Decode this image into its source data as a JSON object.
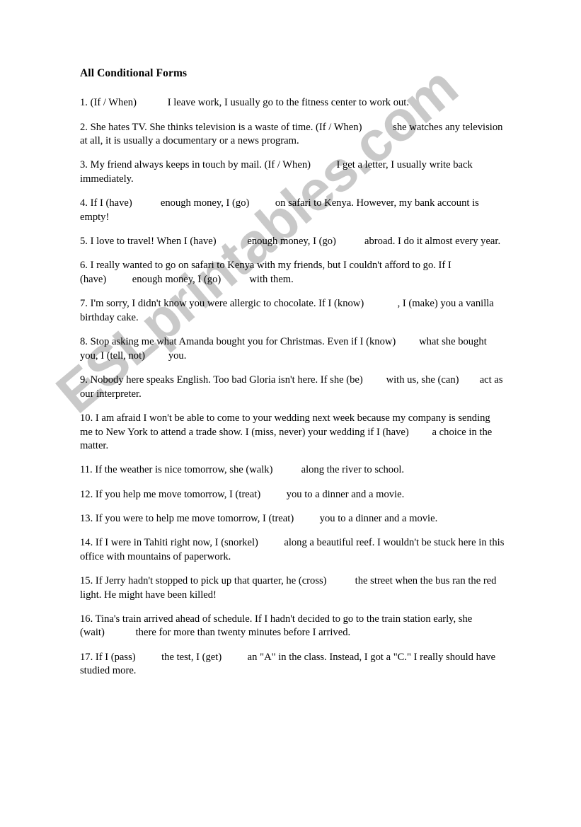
{
  "document": {
    "title": "All Conditional Forms",
    "watermark": "ESLprintables.com",
    "watermark_color": "#c9c9c9",
    "text_color": "#000000",
    "background_color": "#ffffff"
  },
  "exercises": [
    {
      "number": "1.",
      "text": "1. (If / When)            I leave work, I usually go to the fitness center to work out."
    },
    {
      "number": "2.",
      "text": "2. She hates TV. She thinks television is a waste of time. (If / When)            she watches any television at all, it is usually a documentary or a news program."
    },
    {
      "number": "3.",
      "text": "3. My friend always keeps in touch by mail. (If / When)          I get a letter, I usually write back immediately."
    },
    {
      "number": "4.",
      "text": "4. If I (have)           enough money, I (go)          on safari to Kenya. However, my bank account is empty!"
    },
    {
      "number": "5.",
      "text": "5. I love to travel! When I (have)            enough money, I (go)           abroad. I do it almost every year."
    },
    {
      "number": "6.",
      "text": "6. I really wanted to go on safari to Kenya with my friends, but I couldn't afford to go. If I (have)          enough money, I (go)           with them."
    },
    {
      "number": "7.",
      "text": "7. I'm sorry, I didn't know you were allergic to chocolate. If I (know)             , I (make) you a vanilla birthday cake."
    },
    {
      "number": "8.",
      "text": "8. Stop asking me what Amanda bought you for Christmas. Even if I (know)         what she bought you, I (tell, not)         you."
    },
    {
      "number": "9.",
      "text": "9. Nobody here speaks English. Too bad Gloria isn't here. If she (be)         with us, she (can)        act as our interpreter."
    },
    {
      "number": "10.",
      "text": "10. I am afraid I won't be able to come to your wedding next week because my company is sending me to New York to attend a trade show. I (miss, never) your wedding if I (have)         a choice in the matter."
    },
    {
      "number": "11.",
      "text": "11. If the weather is nice tomorrow, she (walk)           along the river to school."
    },
    {
      "number": "12.",
      "text": "12. If you help me move tomorrow, I (treat)          you to a dinner and a movie."
    },
    {
      "number": "13.",
      "text": "13. If you were to help me move tomorrow, I (treat)          you to a dinner and a movie."
    },
    {
      "number": "14.",
      "text": "14. If I were in Tahiti right now, I (snorkel)          along a beautiful reef. I wouldn't be stuck here in this office with mountains of paperwork."
    },
    {
      "number": "15.",
      "text": "15. If Jerry hadn't stopped to pick up that quarter, he (cross)           the street when the bus ran the red light. He might have been killed!"
    },
    {
      "number": "16.",
      "text": "16. Tina's train arrived ahead of schedule. If I hadn't decided to go to the train station early, she (wait)            there for more than twenty minutes before I arrived."
    },
    {
      "number": "17.",
      "text": "17. If I (pass)          the test, I (get)          an \"A\" in the class. Instead, I got a \"C.\" I really should have studied more."
    }
  ]
}
